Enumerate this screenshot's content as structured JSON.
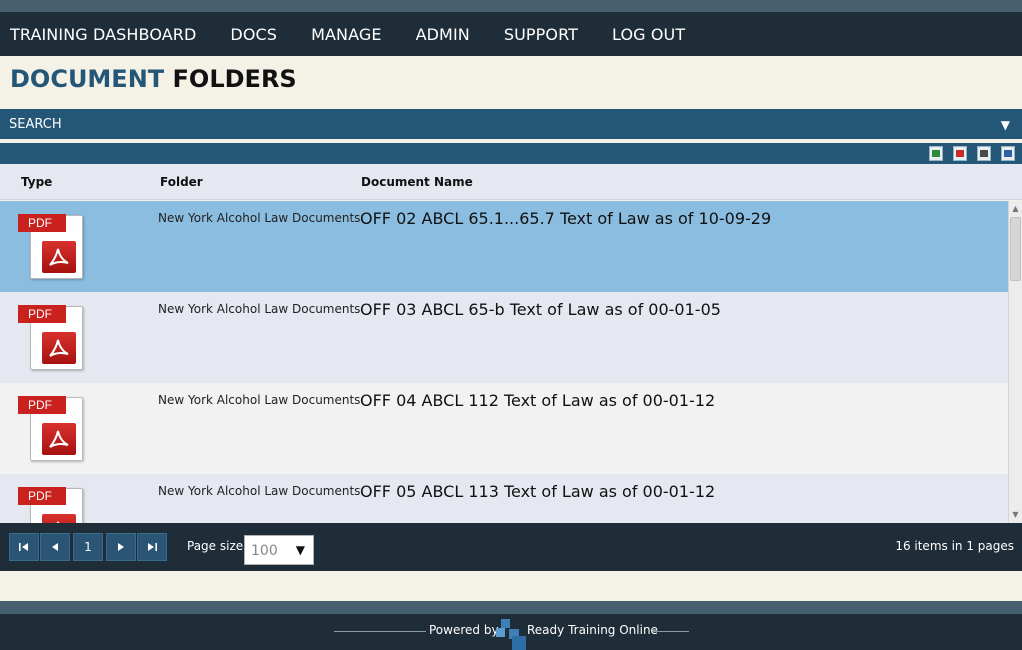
{
  "nav": {
    "items": [
      "TRAINING DASHBOARD",
      "DOCS",
      "MANAGE",
      "ADMIN",
      "SUPPORT",
      "LOG OUT"
    ]
  },
  "page": {
    "title_part1": "DOCUMENT",
    "title_part2": "FOLDERS"
  },
  "search": {
    "label": "SEARCH",
    "toggle_icon": "triangle-down-icon"
  },
  "export_icons": [
    "excel-export-icon",
    "pdf-export-icon",
    "csv-export-icon",
    "word-export-icon"
  ],
  "grid": {
    "columns": [
      "Type",
      "Folder",
      "Document Name"
    ],
    "rows": [
      {
        "type": "PDF",
        "folder": "New York Alcohol Law Documents",
        "document": "OFF 02 ABCL 65.1...65.7 Text of Law as of 10-09-29",
        "selected": true
      },
      {
        "type": "PDF",
        "folder": "New York Alcohol Law Documents",
        "document": "OFF 03 ABCL 65-b Text of Law as of 00-01-05",
        "selected": false
      },
      {
        "type": "PDF",
        "folder": "New York Alcohol Law Documents",
        "document": "OFF 04 ABCL 112 Text of Law as of 00-01-12",
        "selected": false
      },
      {
        "type": "PDF",
        "folder": "New York Alcohol Law Documents",
        "document": "OFF 05 ABCL 113 Text of Law as of 00-01-12",
        "selected": false
      }
    ]
  },
  "pager": {
    "current_page": "1",
    "page_size_label": "Page size:",
    "page_size_value": "100",
    "info": "16 items in 1 pages"
  },
  "footer": {
    "powered_by": "Powered by",
    "brand": "Ready Training Online"
  },
  "colors": {
    "nav_bg": "#1f2d38",
    "accent_blue": "#245678",
    "selected_row": "#8abde0",
    "cream": "#f4f1e6"
  }
}
